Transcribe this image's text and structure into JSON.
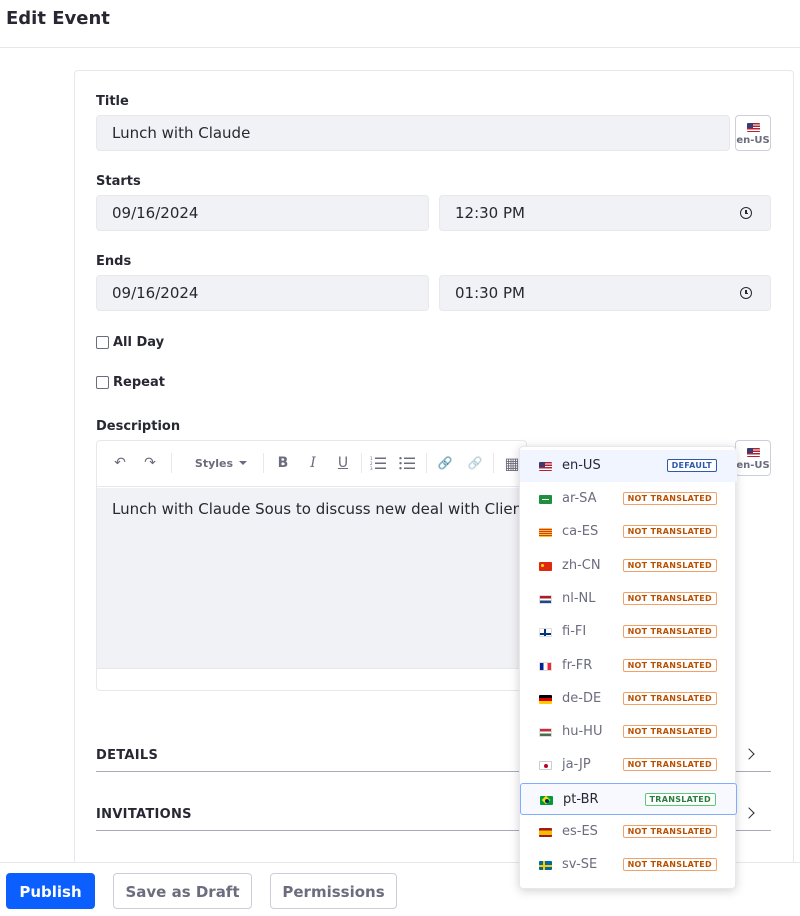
{
  "page": {
    "title": "Edit Event"
  },
  "form": {
    "title_label": "Title",
    "title_value": "Lunch with Claude",
    "locale_code": "en-US",
    "starts_label": "Starts",
    "starts_date": "09/16/2024",
    "starts_time": "12:30 PM",
    "ends_label": "Ends",
    "ends_date": "09/16/2024",
    "ends_time": "01:30 PM",
    "all_day_label": "All Day",
    "repeat_label": "Repeat",
    "description_label": "Description",
    "description_text": "Lunch with Claude Sous to discuss new deal with Client A.",
    "details_label": "DETAILS",
    "invitations_label": "INVITATIONS"
  },
  "toolbar": {
    "undo_glyph": "↶",
    "redo_glyph": "↷",
    "styles_label": "Styles",
    "bold_glyph": "B",
    "italic_glyph": "I",
    "underline_glyph": "U",
    "link_glyph": "🔗",
    "table_glyph": "▦"
  },
  "locale_menu": {
    "items": [
      {
        "code": "en-US",
        "flag": "us-flag-icon",
        "status": "DEFAULT"
      },
      {
        "code": "ar-SA",
        "flag": "sa-flag-icon",
        "status": "NOT TRANSLATED"
      },
      {
        "code": "ca-ES",
        "flag": "catalonia-flag-icon",
        "status": "NOT TRANSLATED"
      },
      {
        "code": "zh-CN",
        "flag": "cn-flag-icon",
        "status": "NOT TRANSLATED"
      },
      {
        "code": "nl-NL",
        "flag": "nl-flag-icon",
        "status": "NOT TRANSLATED"
      },
      {
        "code": "fi-FI",
        "flag": "fi-flag-icon",
        "status": "NOT TRANSLATED"
      },
      {
        "code": "fr-FR",
        "flag": "fr-flag-icon",
        "status": "NOT TRANSLATED"
      },
      {
        "code": "de-DE",
        "flag": "de-flag-icon",
        "status": "NOT TRANSLATED"
      },
      {
        "code": "hu-HU",
        "flag": "hu-flag-icon",
        "status": "NOT TRANSLATED"
      },
      {
        "code": "ja-JP",
        "flag": "jp-flag-icon",
        "status": "NOT TRANSLATED"
      },
      {
        "code": "pt-BR",
        "flag": "br-flag-icon",
        "status": "TRANSLATED"
      },
      {
        "code": "es-ES",
        "flag": "es-flag-icon",
        "status": "NOT TRANSLATED"
      },
      {
        "code": "sv-SE",
        "flag": "se-flag-icon",
        "status": "NOT TRANSLATED"
      }
    ]
  },
  "actions": {
    "publish_label": "Publish",
    "save_draft_label": "Save as Draft",
    "permissions_label": "Permissions"
  },
  "colors": {
    "primary": "#0b5fff",
    "field_bg": "#f1f2f5",
    "badge_default": "#2e5aac",
    "badge_not_translated": "#b95000",
    "badge_translated": "#287d3c"
  }
}
